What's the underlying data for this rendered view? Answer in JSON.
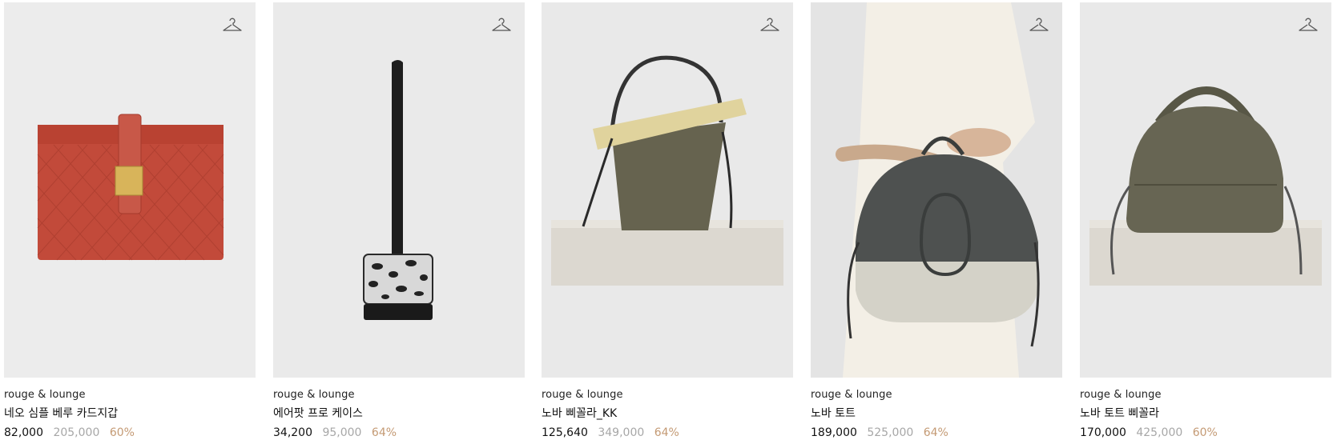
{
  "colors": {
    "discount": "#c49a74",
    "original_price": "#a7a7a7",
    "image_bg": "#ececec"
  },
  "products": [
    {
      "brand": "rouge & lounge",
      "name": "네오 심플 베루 카드지갑",
      "sale_price": "82,000",
      "original_price": "205,000",
      "discount": "60%",
      "icon": "hanger-icon",
      "image": "red woven leather card wallet"
    },
    {
      "brand": "rouge & lounge",
      "name": "에어팟 프로 케이스",
      "sale_price": "34,200",
      "original_price": "95,000",
      "discount": "64%",
      "icon": "hanger-icon",
      "image": "python pattern airpods pro case with strap"
    },
    {
      "brand": "rouge & lounge",
      "name": "노바 삐꼴라_KK",
      "sale_price": "125,640",
      "original_price": "349,000",
      "discount": "64%",
      "icon": "hanger-icon",
      "image": "khaki bucket bag on stone block"
    },
    {
      "brand": "rouge & lounge",
      "name": "노바 토트",
      "sale_price": "189,000",
      "original_price": "525,000",
      "discount": "64%",
      "icon": "hanger-icon",
      "image": "model holding two-tone tote bag"
    },
    {
      "brand": "rouge & lounge",
      "name": "노바 토트 삐꼴라",
      "sale_price": "170,000",
      "original_price": "425,000",
      "discount": "60%",
      "icon": "hanger-icon",
      "image": "olive dome tote on stone block"
    }
  ]
}
